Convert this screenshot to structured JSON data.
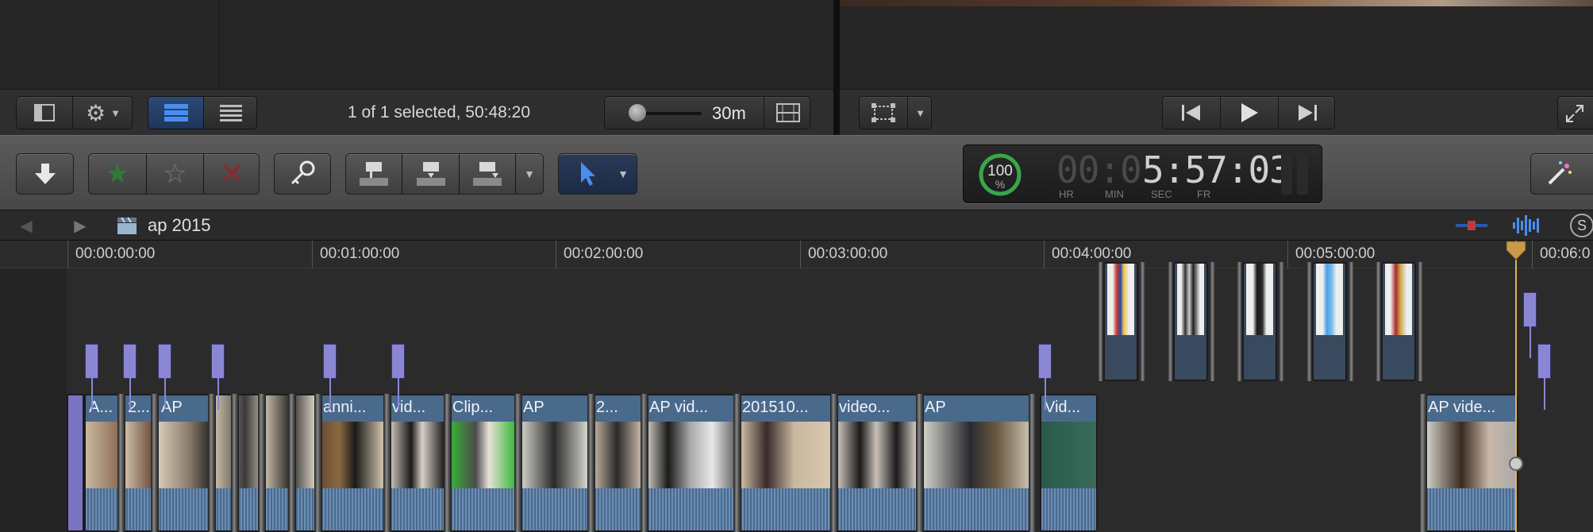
{
  "browser": {
    "selection_status": "1 of 1 selected, 50:48:20",
    "zoom_label": "30m"
  },
  "timecode": {
    "percent": "100",
    "percent_sign": "%",
    "dim_digits": "00:0",
    "value": "5:57:03",
    "labels": [
      "HR",
      "MIN",
      "SEC",
      "FR"
    ]
  },
  "timeline": {
    "project_name": "ap 2015",
    "ruler": [
      "00:00:00:00",
      "00:01:00:00",
      "00:02:00:00",
      "00:03:00:00",
      "00:04:00:00",
      "00:05:00:00",
      "00:06:0"
    ],
    "clips": [
      "A...",
      "2...",
      "AP",
      "anni...",
      "vid...",
      "Clip...",
      "AP",
      "2...",
      "AP vid...",
      "201510...",
      "video...",
      "AP",
      "Vid...",
      "AP vide..."
    ]
  },
  "colors": {
    "accent_blue": "#4a8df0",
    "clip_blue": "#4a6a8c",
    "marker_purple": "#8b86d4",
    "playhead": "#e0b25a",
    "favorite_green": "#2f7a3a",
    "reject_red": "#8a2a2a"
  }
}
